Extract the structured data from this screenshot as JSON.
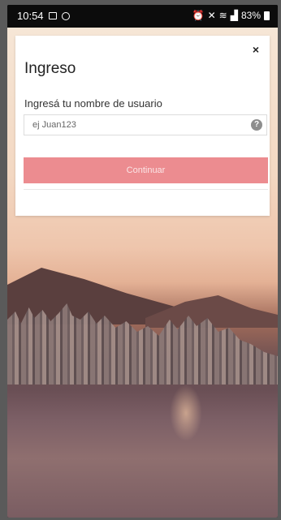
{
  "status_bar": {
    "time": "10:54",
    "battery": "83%"
  },
  "dialog": {
    "close_label": "×",
    "title": "Ingreso",
    "username_label": "Ingresá tu nombre de usuario",
    "username_placeholder": "ej Juan123",
    "username_value": "",
    "help_label": "?",
    "continue_label": "Continuar"
  },
  "colors": {
    "accent": "#ec8c90"
  }
}
